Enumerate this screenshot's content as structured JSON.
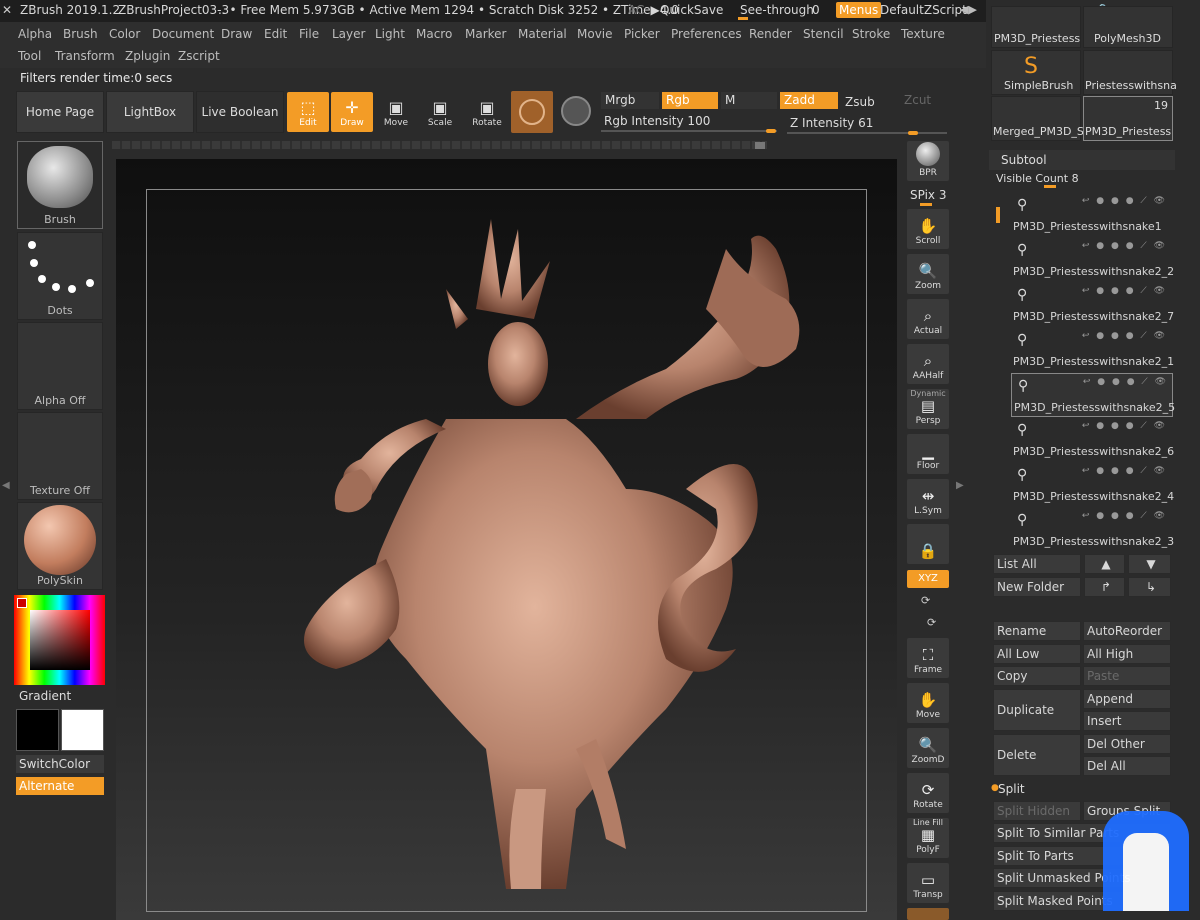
{
  "titlebar": {
    "app": "ZBrush 2019.1.2",
    "project": "ZBrushProject03-3",
    "stats": ".. • Free Mem 5.973GB • Active Mem 1294 • Scratch Disk 3252 • ZTime▶4.0",
    "ac": "AC",
    "quicksave": "QuickSave",
    "see_through": "See-through",
    "see_through_value": "0",
    "menus": "Menus",
    "script": "DefaultZScript"
  },
  "menu": {
    "row1": [
      "Alpha",
      "Brush",
      "Color",
      "Document",
      "Draw",
      "Edit",
      "File",
      "Layer",
      "Light",
      "Macro",
      "Marker",
      "Material",
      "Movie",
      "Picker",
      "Preferences",
      "Render",
      "Stencil",
      "Stroke",
      "Texture"
    ],
    "row2": [
      "Tool",
      "Transform",
      "Zplugin",
      "Zscript"
    ]
  },
  "filters": "Filters render time:0 secs",
  "shelf": {
    "home": "Home Page",
    "lightbox": "LightBox",
    "live_boolean": "Live Boolean",
    "tools": [
      "Edit",
      "Draw",
      "Move",
      "Scale",
      "Rotate"
    ],
    "modes": {
      "mrgb": "Mrgb",
      "rgb": "Rgb",
      "m": "M",
      "zadd": "Zadd",
      "zsub": "Zsub",
      "zcut": "Zcut"
    },
    "rgb_intensity": "Rgb Intensity 100",
    "z_intensity": "Z Intensity 61"
  },
  "left": {
    "brush": "Brush",
    "dots": "Dots",
    "alpha": "Alpha Off",
    "texture": "Texture Off",
    "material": "PolySkin",
    "gradient": "Gradient",
    "switchcolor": "SwitchColor",
    "alternate": "Alternate"
  },
  "right_tools": [
    {
      "label": "BPR",
      "icon": "bpr-sphere-icon"
    },
    {
      "label": "Scroll",
      "icon": "scroll-hand-icon"
    },
    {
      "label": "Zoom",
      "icon": "zoom-icon"
    },
    {
      "label": "Actual",
      "icon": "actual-icon"
    },
    {
      "label": "AAHalf",
      "icon": "aahalf-icon"
    },
    {
      "label": "Persp",
      "icon": "persp-icon"
    },
    {
      "label": "Floor",
      "icon": "floor-icon"
    },
    {
      "label": "L.Sym",
      "icon": "lsym-icon"
    },
    {
      "label": "",
      "icon": "lock-icon"
    },
    {
      "label": "Frame",
      "icon": "frame-icon"
    },
    {
      "label": "Move",
      "icon": "move-hand-icon"
    },
    {
      "label": "ZoomD",
      "icon": "zoom3d-icon"
    },
    {
      "label": "Rotate",
      "icon": "rotate-icon"
    },
    {
      "label": "PolyF",
      "icon": "polyf-icon"
    },
    {
      "label": "Transp",
      "icon": "transp-icon"
    }
  ],
  "spix": "SPix 3",
  "xyz": "XYZ",
  "dynamic": "Dynamic",
  "line_fill": "Line Fill",
  "tool_thumbs": [
    {
      "label": "PM3D_Priestess"
    },
    {
      "label": "PolyMesh3D"
    },
    {
      "label": "SimpleBrush"
    },
    {
      "label": "Priestesswithsna"
    },
    {
      "label": "Merged_PM3D_S"
    },
    {
      "label": "PM3D_Priestess",
      "count": "19"
    }
  ],
  "subtool": {
    "title": "Subtool",
    "visible_count": "Visible Count 8",
    "items": [
      "PM3D_Priestesswithsnake1",
      "PM3D_Priestesswithsnake2_2",
      "PM3D_Priestesswithsnake2_7",
      "PM3D_Priestesswithsnake2_1",
      "PM3D_Priestesswithsnake2_5",
      "PM3D_Priestesswithsnake2_6",
      "PM3D_Priestesswithsnake2_4",
      "PM3D_Priestesswithsnake2_3"
    ]
  },
  "subtool_buttons": {
    "list_all": "List All",
    "new_folder": "New Folder",
    "rename": "Rename",
    "autoreorder": "AutoReorder",
    "all_low": "All Low",
    "all_high": "All High",
    "copy": "Copy",
    "paste": "Paste",
    "duplicate": "Duplicate",
    "append": "Append",
    "insert": "Insert",
    "delete": "Delete",
    "del_other": "Del Other",
    "del_all": "Del All",
    "split": "Split",
    "split_hidden": "Split Hidden",
    "groups_split": "Groups Split",
    "split_similar": "Split To Similar Parts",
    "split_parts": "Split To Parts",
    "split_unmasked": "Split Unmasked Points",
    "split_masked": "Split Masked Points"
  },
  "colors": {
    "accent": "#f39c26",
    "panel": "#3a3a3a",
    "background": "#2b2b2b",
    "model": "#c08f78"
  }
}
